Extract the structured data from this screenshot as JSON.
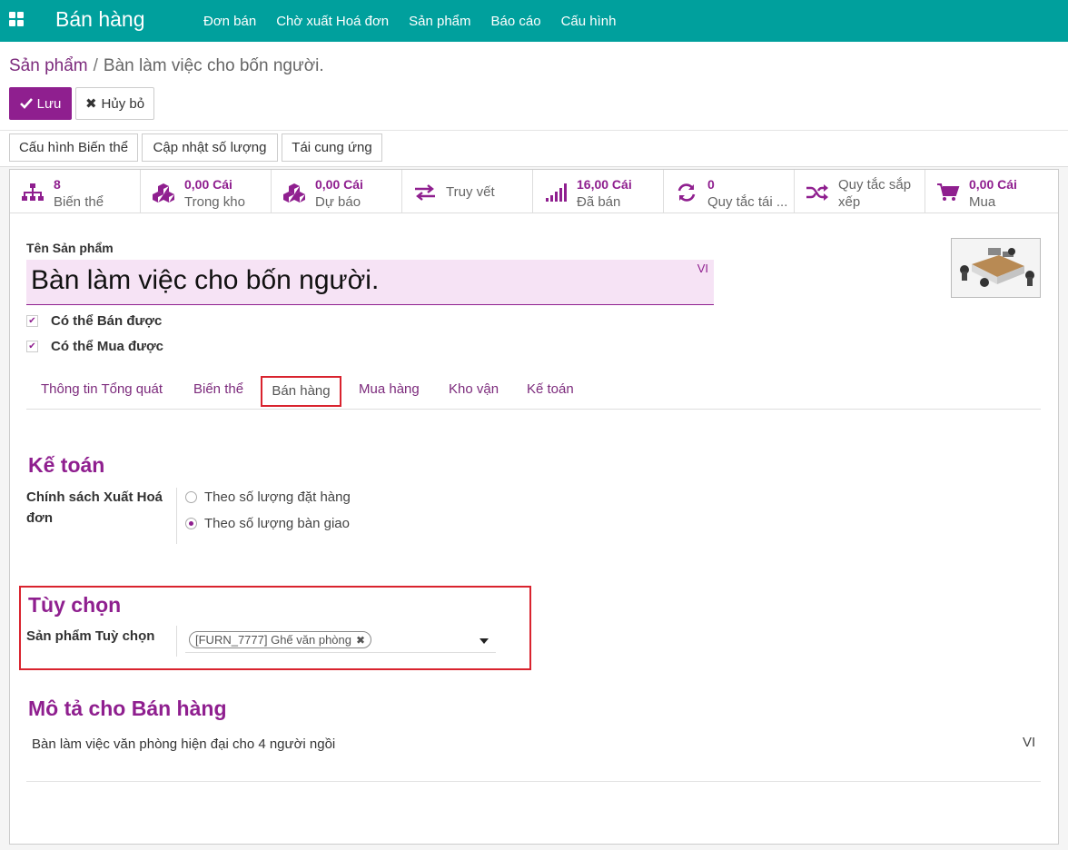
{
  "navbar": {
    "app_title": "Bán hàng",
    "menu": [
      "Đơn bán",
      "Chờ xuất Hoá đơn",
      "Sản phẩm",
      "Báo cáo",
      "Cấu hình"
    ]
  },
  "breadcrumb": {
    "parent": "Sản phẩm",
    "separator": "/",
    "current": "Bàn làm việc cho bốn người."
  },
  "buttons": {
    "save": "Lưu",
    "cancel": "Hủy bỏ"
  },
  "actions": [
    "Cấu hình Biến thể",
    "Cập nhật số lượng",
    "Tái cung ứng"
  ],
  "stats": [
    {
      "value": "8",
      "label": "Biến thể",
      "icon": "sitemap-icon"
    },
    {
      "value": "0,00 Cái",
      "label": "Trong kho",
      "icon": "cubes-icon"
    },
    {
      "value": "0,00 Cái",
      "label": "Dự báo",
      "icon": "cubes-icon"
    },
    {
      "label": "Truy vết",
      "icon": "exchange-icon"
    },
    {
      "value": "16,00 Cái",
      "label": "Đã bán",
      "icon": "signal-icon"
    },
    {
      "value": "0",
      "label": "Quy tắc tái ...",
      "icon": "refresh-icon"
    },
    {
      "label_line1": "Quy tắc sắp",
      "label_line2": "xếp",
      "icon": "shuffle-icon"
    },
    {
      "value": "0,00 Cái",
      "label": "Mua",
      "icon": "cart-icon"
    }
  ],
  "product": {
    "name_label": "Tên Sản phẩm",
    "name": "Bàn làm việc cho bốn người.",
    "lang": "VI",
    "can_sell": "Có thể Bán được",
    "can_purchase": "Có thể Mua được"
  },
  "tabs": [
    "Thông tin Tổng quát",
    "Biến thể",
    "Bán hàng",
    "Mua hàng",
    "Kho vận",
    "Kế toán"
  ],
  "accounting": {
    "title": "Kế toán",
    "policy_label_line1": "Chính sách Xuất Hoá",
    "policy_label_line2": "đơn",
    "options": [
      "Theo số lượng đặt hàng",
      "Theo số lượng bàn giao"
    ],
    "selected_index": 1
  },
  "optional": {
    "title": "Tùy chọn",
    "field_label": "Sản phẩm Tuỳ chọn",
    "tag": "[FURN_7777] Ghế văn phòng"
  },
  "sales_desc": {
    "title": "Mô tả cho Bán hàng",
    "text": "Bàn làm việc văn phòng hiện đại cho 4 người ngồi",
    "lang": "VI"
  },
  "colors": {
    "navbar": "#00a09d",
    "primary": "#8f1f8f",
    "highlight_border": "#d9232e"
  }
}
